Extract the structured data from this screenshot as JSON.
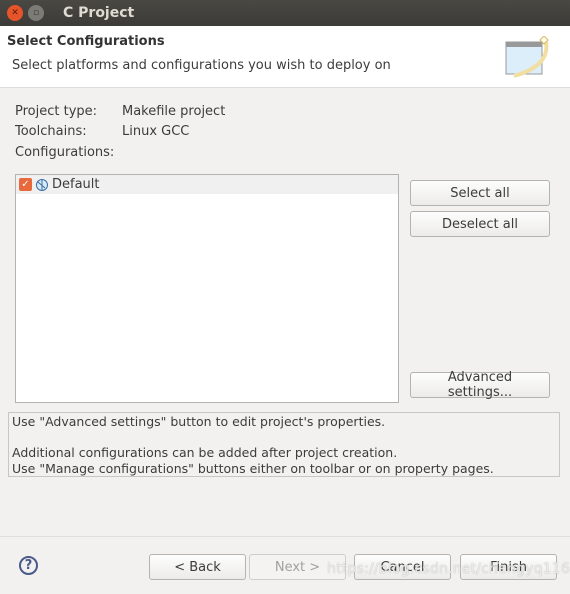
{
  "window": {
    "title": "C Project"
  },
  "header": {
    "title": "Select Configurations",
    "subtitle": "Select platforms and configurations you wish to deploy on"
  },
  "info": {
    "project_type_label": "Project type:",
    "project_type": "Makefile project",
    "toolchains_label": "Toolchains:",
    "toolchains": "Linux GCC",
    "configurations_label": "Configurations:"
  },
  "configurations": [
    {
      "name": "Default",
      "checked": true
    }
  ],
  "buttons": {
    "select_all": "Select all",
    "deselect_all": "Deselect all",
    "advanced": "Advanced settings...",
    "back": "< Back",
    "next": "Next >",
    "cancel": "Cancel",
    "finish": "Finish"
  },
  "message": {
    "line1": "Use \"Advanced settings\" button to edit project's properties.",
    "line2": "Additional configurations can be added after project creation.",
    "line3": "Use \"Manage configurations\" buttons either on toolbar or on property pages."
  },
  "watermark": "https://blog.csdn.net/chengyq116",
  "colors": {
    "accent": "#e8693b",
    "titlebar": "#3c3b37"
  }
}
